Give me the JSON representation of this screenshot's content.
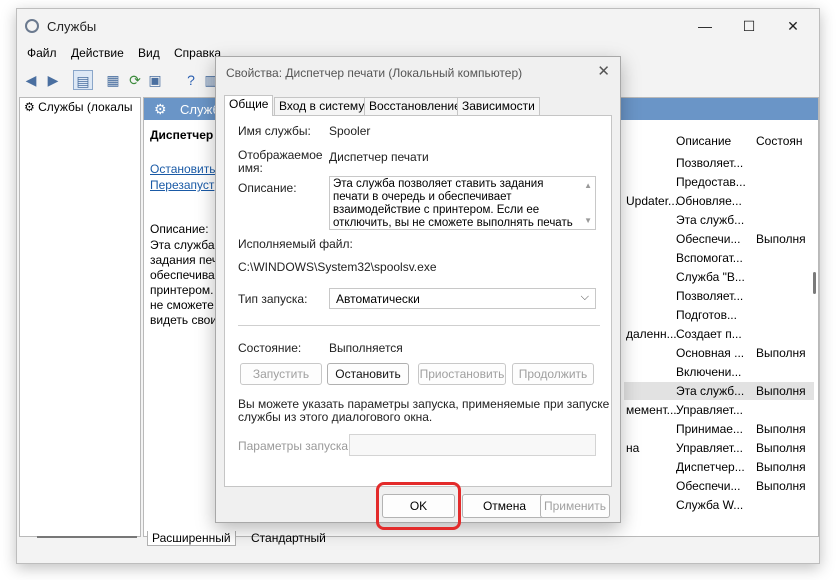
{
  "window": {
    "title": "Службы",
    "controls": {
      "minimize": "—",
      "maximize": "☐",
      "close": "✕"
    }
  },
  "menu": [
    "Файл",
    "Действие",
    "Вид",
    "Справка"
  ],
  "tree": {
    "root_label": "Службы (локалы"
  },
  "pane": {
    "header_title": "Служб",
    "service_name": "Диспетчер п",
    "stop_link": "Остановить",
    "restart_link": "Перезапуст",
    "description_label": "Описание:",
    "description_lines": [
      "Эта служба п",
      "задания печа",
      "обеспечивае",
      "принтером.",
      "не сможете",
      "видеть свои"
    ]
  },
  "columns": {
    "description": "Описание",
    "status": "Состоян"
  },
  "rows": [
    {
      "name": "",
      "description": "Позволяет...",
      "status": ""
    },
    {
      "name": "",
      "description": "Предостав...",
      "status": ""
    },
    {
      "name": "Updater...",
      "description": "Обновляе...",
      "status": ""
    },
    {
      "name": "",
      "description": "Эта служб...",
      "status": ""
    },
    {
      "name": "",
      "description": "Обеспечи...",
      "status": "Выполня"
    },
    {
      "name": "",
      "description": "Вспомогат...",
      "status": ""
    },
    {
      "name": "",
      "description": "Служба \"В...",
      "status": ""
    },
    {
      "name": "",
      "description": "Позволяет...",
      "status": ""
    },
    {
      "name": "",
      "description": "Подготов...",
      "status": ""
    },
    {
      "name": "даленн...",
      "description": "Создает п...",
      "status": ""
    },
    {
      "name": "",
      "description": "Основная ...",
      "status": "Выполня"
    },
    {
      "name": "",
      "description": "Включени...",
      "status": ""
    },
    {
      "name": "",
      "description": "Эта служб...",
      "status": "Выполня",
      "selected": true
    },
    {
      "name": "мемент...",
      "description": "Управляет...",
      "status": ""
    },
    {
      "name": "",
      "description": "Принимае...",
      "status": "Выполня"
    },
    {
      "name": "на",
      "description": "Управляет...",
      "status": "Выполня"
    },
    {
      "name": "",
      "description": "Диспетчер...",
      "status": "Выполня"
    },
    {
      "name": "",
      "description": "Обеспечи...",
      "status": "Выполня"
    },
    {
      "name": "",
      "description": "Служба W...",
      "status": ""
    }
  ],
  "bottom_tabs": [
    "Расширенный",
    "Стандартный"
  ],
  "dialog": {
    "title": "Свойства: Диспетчер печати (Локальный компьютер)",
    "tabs": [
      "Общие",
      "Вход в систему",
      "Восстановление",
      "Зависимости"
    ],
    "service_name_label": "Имя службы:",
    "service_name_value": "Spooler",
    "display_name_label_1": "Отображаемое",
    "display_name_label_2": "имя:",
    "display_name_value": "Диспетчер печати",
    "description_label": "Описание:",
    "description_value": "Эта служба позволяет ставить задания печати в очередь и обеспечивает взаимодействие с принтером.  Если ее отключить, вы не сможете выполнять печать и видеть свои принтеры.",
    "exec_label": "Исполняемый файл:",
    "exec_path": "C:\\WINDOWS\\System32\\spoolsv.exe",
    "startup_label": "Тип запуска:",
    "startup_value": "Автоматически",
    "state_label": "Состояние:",
    "state_value": "Выполняется",
    "btn_start": "Запустить",
    "btn_stop": "Остановить",
    "btn_pause": "Приостановить",
    "btn_resume": "Продолжить",
    "hint_line1": "Вы можете указать параметры запуска, применяемые при запуске",
    "hint_line2": "службы из этого диалогового окна.",
    "params_label": "Параметры запуска:",
    "ok": "OK",
    "cancel": "Отмена",
    "apply": "Применить"
  },
  "colors": {
    "pane_header": "#6a95c7",
    "highlight": "#e32b2b",
    "link": "#1a5aa6"
  }
}
